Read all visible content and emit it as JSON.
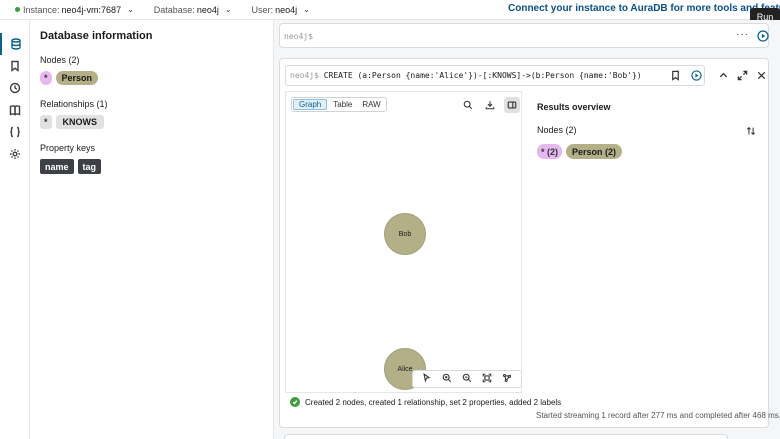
{
  "topbar": {
    "instance_label": "Instance:",
    "instance_value": "neo4j-vm:7687",
    "database_label": "Database:",
    "database_value": "neo4j",
    "user_label": "User:",
    "user_value": "neo4j",
    "connect_text": "Connect your instance to AuraDB for more tools and features",
    "run_tooltip": "Run"
  },
  "db_info": {
    "title": "Database information",
    "nodes_title": "Nodes (2)",
    "node_labels": [
      "*",
      "Person"
    ],
    "relationships_title": "Relationships (1)",
    "relationship_types": [
      "*",
      "KNOWS"
    ],
    "property_keys_title": "Property keys",
    "property_keys": [
      "name",
      "tag"
    ]
  },
  "editor": {
    "prompt": "neo4j$"
  },
  "frame": {
    "prompt": "neo4j$",
    "query": "CREATE (a:Person {name:'Alice'})-[:KNOWS]->(b:Person {name:'Bob'})",
    "view_tabs": [
      "Graph",
      "Table",
      "RAW"
    ],
    "active_tab": "Graph",
    "nodes": [
      {
        "label": "Bob"
      },
      {
        "label": "Alice"
      }
    ],
    "overview_title": "Results overview",
    "overview_nodes": "Nodes (2)",
    "overview_chips": [
      "* (2)",
      "Person (2)"
    ],
    "status_text": "Created 2 nodes, created 1 relationship, set 2 properties, added 2 labels",
    "stream_text": "Started streaming 1 record after 277 ms and completed after 468 ms."
  },
  "colors": {
    "person": "#b3af86",
    "star": "#e5b8ef",
    "accent": "#0a6190",
    "success": "#3c9d3c"
  }
}
